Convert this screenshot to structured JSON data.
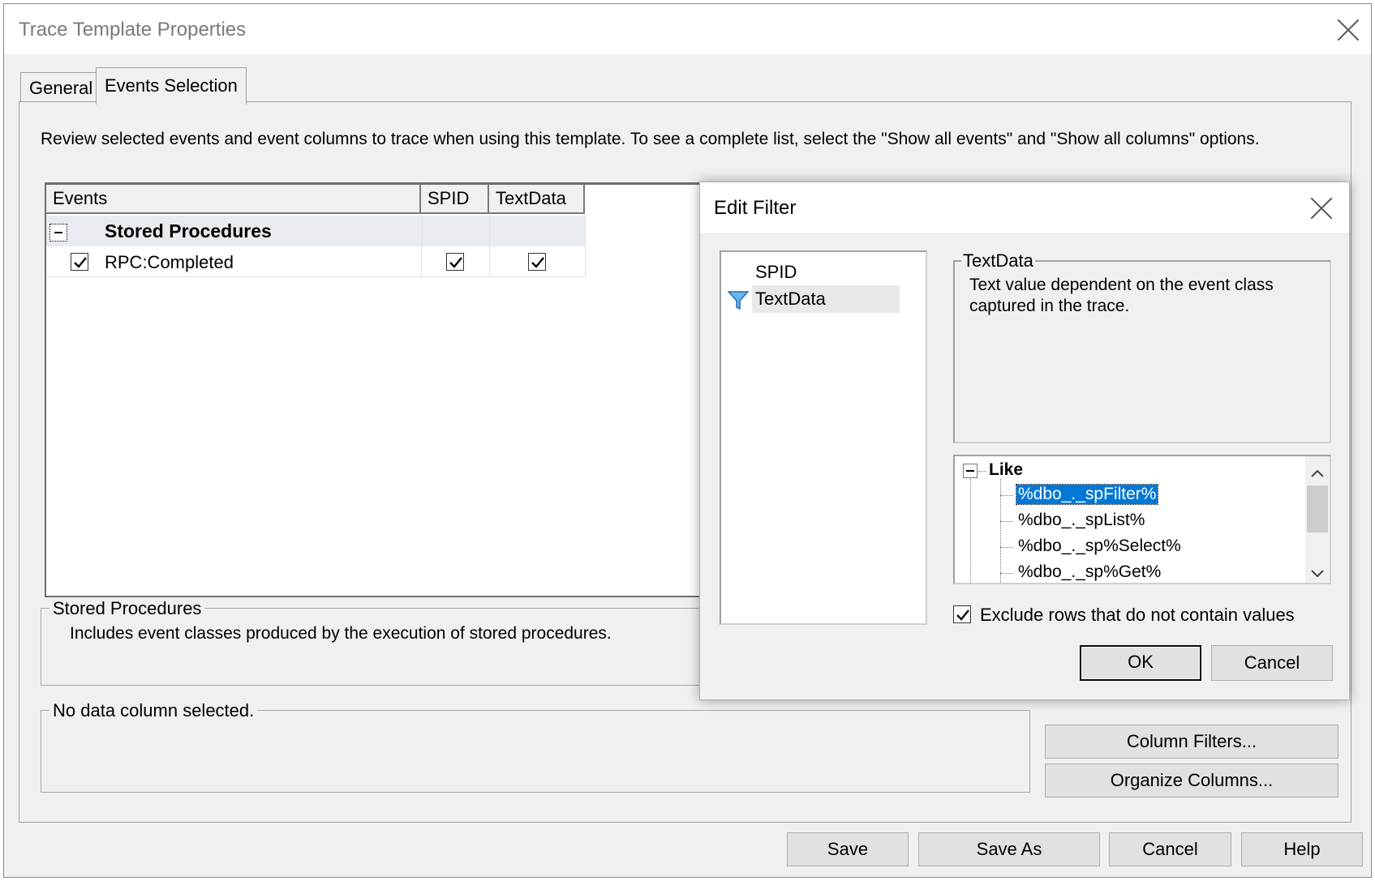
{
  "window": {
    "title": "Trace Template Properties"
  },
  "tabs": [
    {
      "label": "General",
      "active": false
    },
    {
      "label": "Events Selection",
      "active": true
    }
  ],
  "intro_text": "Review selected events and event columns to trace when using this template. To see a complete list, select the \"Show all events\" and \"Show all columns\" options.",
  "events_grid": {
    "columns": [
      "Events",
      "SPID",
      "TextData"
    ],
    "category": {
      "label": "Stored Procedures",
      "expanded": true
    },
    "rows": [
      {
        "label": "RPC:Completed",
        "checked": true,
        "SPID": true,
        "TextData": true
      }
    ]
  },
  "category_info": {
    "title": "Stored Procedures",
    "description": "Includes event classes produced by the execution of stored procedures."
  },
  "column_info": {
    "title": "No data column selected."
  },
  "side_buttons": {
    "column_filters": "Column Filters...",
    "organize_columns": "Organize Columns..."
  },
  "footer_buttons": {
    "save": "Save",
    "save_as": "Save As",
    "cancel": "Cancel",
    "help": "Help"
  },
  "edit_filter": {
    "title": "Edit Filter",
    "columns": [
      {
        "label": "SPID",
        "filtered": false,
        "selected": false
      },
      {
        "label": "TextData",
        "filtered": true,
        "selected": true
      }
    ],
    "description_title": "TextData",
    "description": "Text value dependent on the event class captured in the trace.",
    "tree": {
      "operator": "Like",
      "values": [
        "%dbo_._spFilter%",
        "%dbo_._spList%",
        "%dbo_._sp%Select%",
        "%dbo_._sp%Get%"
      ],
      "selected_index": 0
    },
    "exclude_label": "Exclude rows that do not contain values",
    "exclude_checked": true,
    "ok_label": "OK",
    "cancel_label": "Cancel"
  }
}
